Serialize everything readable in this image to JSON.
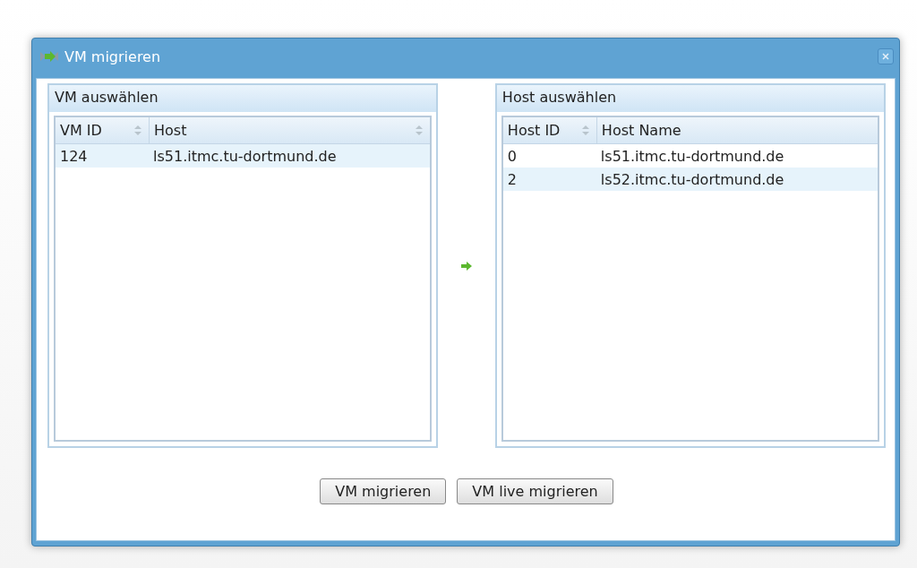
{
  "window": {
    "title": "VM migrieren"
  },
  "panels": [
    {
      "title": "VM auswählen",
      "columns": [
        {
          "label": "VM ID",
          "sortable": true
        },
        {
          "label": "Host",
          "sortable": true
        }
      ],
      "rows": [
        {
          "cells": [
            "124",
            "ls51.itmc.tu-dortmund.de"
          ],
          "selected": true
        }
      ]
    },
    {
      "title": "Host auswählen",
      "columns": [
        {
          "label": "Host ID",
          "sortable": true
        },
        {
          "label": "Host Name",
          "sortable": false
        }
      ],
      "rows": [
        {
          "cells": [
            "0",
            "ls51.itmc.tu-dortmund.de"
          ],
          "selected": false
        },
        {
          "cells": [
            "2",
            "ls52.itmc.tu-dortmund.de"
          ],
          "selected": true
        }
      ]
    }
  ],
  "buttons": [
    "VM migrieren",
    "VM live migrieren"
  ]
}
